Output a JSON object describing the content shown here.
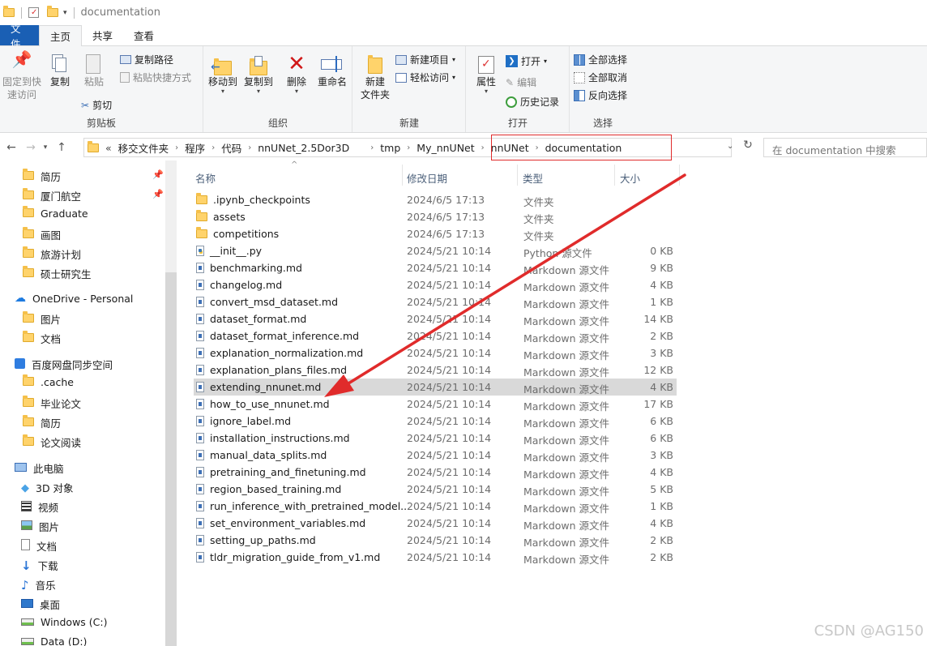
{
  "window": {
    "title": "documentation"
  },
  "ribbon_tabs": [
    "文件",
    "主页",
    "共享",
    "查看"
  ],
  "ribbon": {
    "clipboard": {
      "label": "剪贴板",
      "pin": "固定到快\n速访问",
      "copy": "复制",
      "paste": "粘贴",
      "copy_path": "复制路径",
      "paste_shortcut": "粘贴快捷方式",
      "cut": "剪切"
    },
    "organize": {
      "label": "组织",
      "move_to": "移动到",
      "copy_to": "复制到",
      "delete": "删除",
      "rename": "重命名"
    },
    "new": {
      "label": "新建",
      "new_folder": "新建\n文件夹",
      "new_item": "新建项目",
      "easy_access": "轻松访问"
    },
    "open": {
      "label": "打开",
      "properties": "属性",
      "open": "打开",
      "edit": "编辑",
      "history": "历史记录"
    },
    "select": {
      "label": "选择",
      "select_all": "全部选择",
      "select_none": "全部取消",
      "invert": "反向选择"
    }
  },
  "address": {
    "overflow": "«",
    "crumbs": [
      "移交文件夹",
      "程序",
      "代码",
      "nnUNet_2.5Dor3D",
      "tmp",
      "My_nnUNet",
      "nnUNet",
      "documentation"
    ],
    "search_placeholder": "在 documentation 中搜索"
  },
  "sidebar": {
    "items": [
      {
        "label": "简历",
        "icon": "folder-icon",
        "pinned": true
      },
      {
        "label": "厦门航空",
        "icon": "folder-icon",
        "pinned": true
      },
      {
        "label": "Graduate",
        "icon": "folder-icon"
      },
      {
        "label": "画图",
        "icon": "folder-icon"
      },
      {
        "label": "旅游计划",
        "icon": "folder-icon"
      },
      {
        "label": "硕士研究生",
        "icon": "folder-icon"
      },
      {
        "label": "OneDrive - Personal",
        "icon": "cloud-icon"
      },
      {
        "label": "图片",
        "icon": "folder-icon"
      },
      {
        "label": "文档",
        "icon": "folder-icon"
      },
      {
        "label": "百度网盘同步空间",
        "icon": "baidu-sync-icon"
      },
      {
        "label": ".cache",
        "icon": "folder-icon"
      },
      {
        "label": "毕业论文",
        "icon": "folder-icon"
      },
      {
        "label": "简历",
        "icon": "folder-icon"
      },
      {
        "label": "论文阅读",
        "icon": "folder-icon"
      },
      {
        "label": "此电脑",
        "icon": "pc-icon"
      },
      {
        "label": "3D 对象",
        "icon": "cube-icon"
      },
      {
        "label": "视频",
        "icon": "video-icon"
      },
      {
        "label": "图片",
        "icon": "pictures-icon"
      },
      {
        "label": "文档",
        "icon": "documents-icon"
      },
      {
        "label": "下载",
        "icon": "download-icon"
      },
      {
        "label": "音乐",
        "icon": "music-icon"
      },
      {
        "label": "桌面",
        "icon": "desktop-icon"
      },
      {
        "label": "Windows (C:)",
        "icon": "drive-icon"
      },
      {
        "label": "Data (D:)",
        "icon": "drive-icon"
      }
    ]
  },
  "columns": {
    "name": "名称",
    "date": "修改日期",
    "type": "类型",
    "size": "大小"
  },
  "files": [
    {
      "name": ".ipynb_checkpoints",
      "date": "2024/6/5 17:13",
      "type": "文件夹",
      "size": "",
      "kind": "folder"
    },
    {
      "name": "assets",
      "date": "2024/6/5 17:13",
      "type": "文件夹",
      "size": "",
      "kind": "folder"
    },
    {
      "name": "competitions",
      "date": "2024/6/5 17:13",
      "type": "文件夹",
      "size": "",
      "kind": "folder"
    },
    {
      "name": "__init__.py",
      "date": "2024/5/21 10:14",
      "type": "Python 源文件",
      "size": "0 KB",
      "kind": "py"
    },
    {
      "name": "benchmarking.md",
      "date": "2024/5/21 10:14",
      "type": "Markdown 源文件",
      "size": "9 KB",
      "kind": "md"
    },
    {
      "name": "changelog.md",
      "date": "2024/5/21 10:14",
      "type": "Markdown 源文件",
      "size": "4 KB",
      "kind": "md"
    },
    {
      "name": "convert_msd_dataset.md",
      "date": "2024/5/21 10:14",
      "type": "Markdown 源文件",
      "size": "1 KB",
      "kind": "md"
    },
    {
      "name": "dataset_format.md",
      "date": "2024/5/21 10:14",
      "type": "Markdown 源文件",
      "size": "14 KB",
      "kind": "md"
    },
    {
      "name": "dataset_format_inference.md",
      "date": "2024/5/21 10:14",
      "type": "Markdown 源文件",
      "size": "2 KB",
      "kind": "md"
    },
    {
      "name": "explanation_normalization.md",
      "date": "2024/5/21 10:14",
      "type": "Markdown 源文件",
      "size": "3 KB",
      "kind": "md"
    },
    {
      "name": "explanation_plans_files.md",
      "date": "2024/5/21 10:14",
      "type": "Markdown 源文件",
      "size": "12 KB",
      "kind": "md"
    },
    {
      "name": "extending_nnunet.md",
      "date": "2024/5/21 10:14",
      "type": "Markdown 源文件",
      "size": "4 KB",
      "kind": "md",
      "highlighted": true
    },
    {
      "name": "how_to_use_nnunet.md",
      "date": "2024/5/21 10:14",
      "type": "Markdown 源文件",
      "size": "17 KB",
      "kind": "md"
    },
    {
      "name": "ignore_label.md",
      "date": "2024/5/21 10:14",
      "type": "Markdown 源文件",
      "size": "6 KB",
      "kind": "md"
    },
    {
      "name": "installation_instructions.md",
      "date": "2024/5/21 10:14",
      "type": "Markdown 源文件",
      "size": "6 KB",
      "kind": "md"
    },
    {
      "name": "manual_data_splits.md",
      "date": "2024/5/21 10:14",
      "type": "Markdown 源文件",
      "size": "3 KB",
      "kind": "md"
    },
    {
      "name": "pretraining_and_finetuning.md",
      "date": "2024/5/21 10:14",
      "type": "Markdown 源文件",
      "size": "4 KB",
      "kind": "md"
    },
    {
      "name": "region_based_training.md",
      "date": "2024/5/21 10:14",
      "type": "Markdown 源文件",
      "size": "5 KB",
      "kind": "md"
    },
    {
      "name": "run_inference_with_pretrained_model...",
      "date": "2024/5/21 10:14",
      "type": "Markdown 源文件",
      "size": "1 KB",
      "kind": "md"
    },
    {
      "name": "set_environment_variables.md",
      "date": "2024/5/21 10:14",
      "type": "Markdown 源文件",
      "size": "4 KB",
      "kind": "md"
    },
    {
      "name": "setting_up_paths.md",
      "date": "2024/5/21 10:14",
      "type": "Markdown 源文件",
      "size": "2 KB",
      "kind": "md"
    },
    {
      "name": "tldr_migration_guide_from_v1.md",
      "date": "2024/5/21 10:14",
      "type": "Markdown 源文件",
      "size": "2 KB",
      "kind": "md"
    }
  ],
  "watermark": "CSDN @AG150",
  "colors": {
    "annotation": "#e02b2b",
    "file_tab": "#1a5fb4",
    "folder": "#ffd36b",
    "highlight_row": "#d9d9d9"
  }
}
